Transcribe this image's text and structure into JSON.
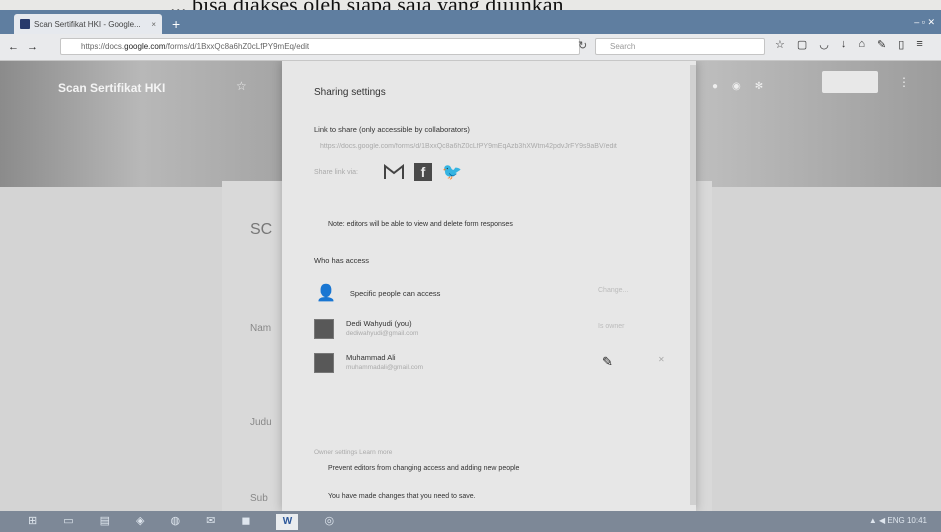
{
  "caption": "... bisa diakses oleh siapa saja yang diijinkan",
  "browser": {
    "tab_title": "Scan Sertifikat HKI - Google...",
    "tab_close": "×",
    "new_tab": "+",
    "window_controls": "‒ ▫ ✕",
    "url_prefix": "https://docs.",
    "url_domain": "google.com",
    "url_suffix": "/forms/d/1BxxQc8a6hZ0cLfPY9mEq/edit",
    "search_placeholder": "Search"
  },
  "form": {
    "header_title": "Scan Sertifikat HKI",
    "title_partial": "SC",
    "field_name": "Nam",
    "field_title": "Judu",
    "field_sub": "Sub"
  },
  "dialog": {
    "title": "Sharing settings",
    "link_label": "Link to share (only accessible by collaborators)",
    "link_url": "https://docs.google.com/forms/d/1BxxQc8a6hZ0cLfPY9mEqAzb3hXWtm42pdvJrFY9s9aBV/edit",
    "share_via": "Share link via:",
    "note": "Note: editors will be able to view and delete form responses",
    "who_has_access": "Who has access",
    "access_level": "Specific people can access",
    "change_link": "Change...",
    "people": [
      {
        "name": "Dedi Wahyudi (you)",
        "email": "dediwahyudi@gmail.com",
        "role": "Is owner"
      },
      {
        "name": "Muhammad Ali",
        "email": "muhammadali@gmail.com",
        "role": ""
      }
    ],
    "owner_settings": "Owner settings  Learn more",
    "prevent_editors": "Prevent editors from changing access and adding new people",
    "unsaved": "You have made changes that you need to save."
  },
  "taskbar": {
    "tray_text": "▲ ◀ ENG 10:41"
  }
}
